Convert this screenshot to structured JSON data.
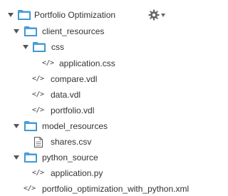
{
  "project": {
    "name": "Portfolio Optimization",
    "settings_icon": "gear-icon",
    "settings_dropdown_icon": "caret-down-icon",
    "folder_color": "#4aa3df"
  },
  "tree": {
    "client_resources": "client_resources",
    "css": "css",
    "application_css": "application.css",
    "compare_vdl": "compare.vdl",
    "data_vdl": "data.vdl",
    "portfolio_vdl": "portfolio.vdl",
    "model_resources": "model_resources",
    "shares_csv": "shares.csv",
    "python_source": "python_source",
    "application_py": "application.py",
    "portfolio_xml": "portfolio_optimization_with_python.xml"
  },
  "icons": {
    "code": "</>"
  }
}
